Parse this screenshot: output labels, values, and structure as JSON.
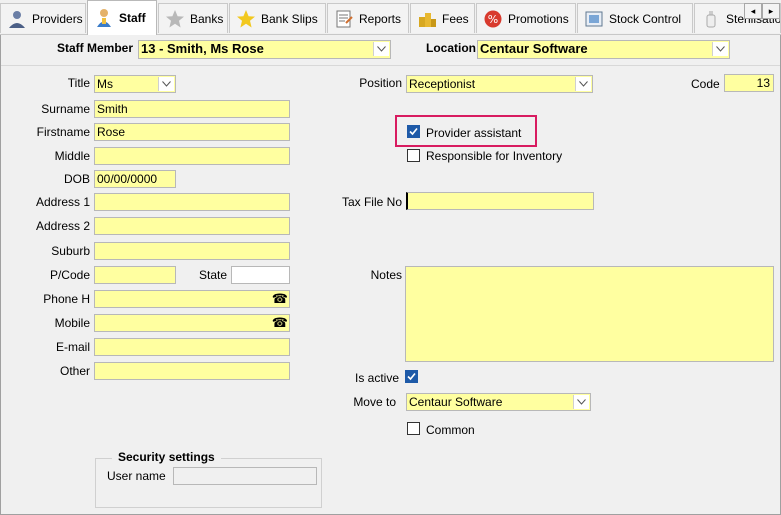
{
  "tabs": [
    {
      "label": "Providers",
      "icon": "person-icon"
    },
    {
      "label": "Staff",
      "icon": "staff-icon",
      "active": true
    },
    {
      "label": "Banks",
      "icon": "star-icon"
    },
    {
      "label": "Bank Slips",
      "icon": "star-icon"
    },
    {
      "label": "Reports",
      "icon": "report-icon"
    },
    {
      "label": "Fees",
      "icon": "coins-icon"
    },
    {
      "label": "Promotions",
      "icon": "promotion-icon"
    },
    {
      "label": "Stock Control",
      "icon": "stock-icon"
    },
    {
      "label": "Sterilisation",
      "icon": "bottle-icon"
    }
  ],
  "tab_scroll": {
    "left": "◂",
    "right": "▸"
  },
  "header": {
    "staff_member_label": "Staff Member",
    "staff_member_value": "13 - Smith, Ms Rose",
    "location_label": "Location",
    "location_value": "Centaur Software"
  },
  "form": {
    "title_label": "Title",
    "title_value": "Ms",
    "surname_label": "Surname",
    "surname_value": "Smith",
    "firstname_label": "Firstname",
    "firstname_value": "Rose",
    "middle_label": "Middle",
    "middle_value": "",
    "dob_label": "DOB",
    "dob_value": "00/00/0000",
    "address1_label": "Address 1",
    "address1_value": "",
    "address2_label": "Address 2",
    "address2_value": "",
    "suburb_label": "Suburb",
    "suburb_value": "",
    "pcode_label": "P/Code",
    "pcode_value": "",
    "state_label": "State",
    "state_value": "",
    "phoneh_label": "Phone H",
    "phoneh_value": "",
    "mobile_label": "Mobile",
    "mobile_value": "",
    "email_label": "E-mail",
    "email_value": "",
    "other_label": "Other",
    "other_value": "",
    "position_label": "Position",
    "position_value": "Receptionist",
    "code_label": "Code",
    "code_value": "13",
    "provider_assistant_label": "Provider assistant",
    "provider_assistant_checked": true,
    "responsible_inventory_label": "Responsible for Inventory",
    "responsible_inventory_checked": false,
    "taxfile_label": "Tax File No",
    "taxfile_value": "",
    "notes_label": "Notes",
    "is_active_label": "Is active",
    "is_active_checked": true,
    "move_to_label": "Move to",
    "move_to_value": "Centaur Software",
    "common_label": "Common",
    "common_checked": false
  },
  "security": {
    "title": "Security settings",
    "username_label": "User name",
    "username_value": ""
  },
  "icons": {
    "phone": "☎"
  },
  "colors": {
    "field_yellow": "#ffffa0",
    "highlight": "#d81b60",
    "checkbox": "#1e5aa8"
  }
}
